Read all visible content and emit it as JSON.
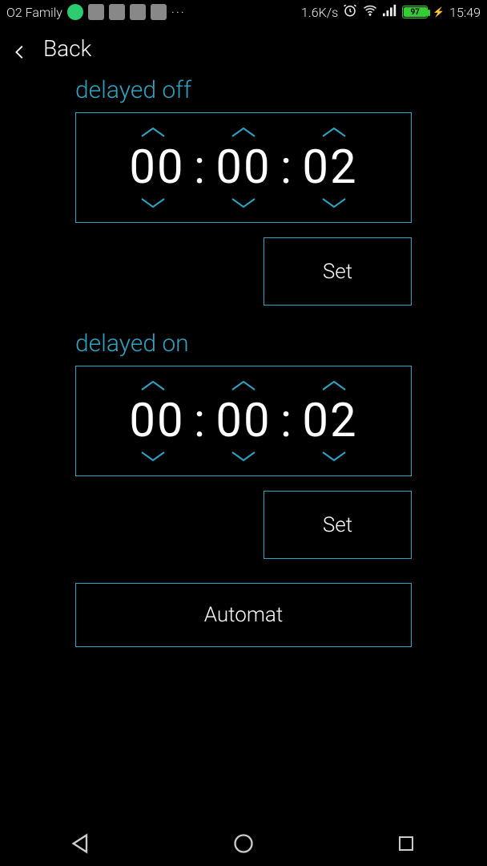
{
  "status_bar": {
    "carrier": "O2 Family",
    "speed": "1.6K/s",
    "battery_pct": "97",
    "time": "15:49"
  },
  "back_label": "Back",
  "sections": {
    "off": {
      "title": "delayed off",
      "hh": "00",
      "mm": "00",
      "ss": "02",
      "set_label": "Set"
    },
    "on": {
      "title": "delayed on",
      "hh": "00",
      "mm": "00",
      "ss": "02",
      "set_label": "Set"
    }
  },
  "automat_label": "Automat",
  "colors": {
    "accent": "#2da4c2"
  }
}
